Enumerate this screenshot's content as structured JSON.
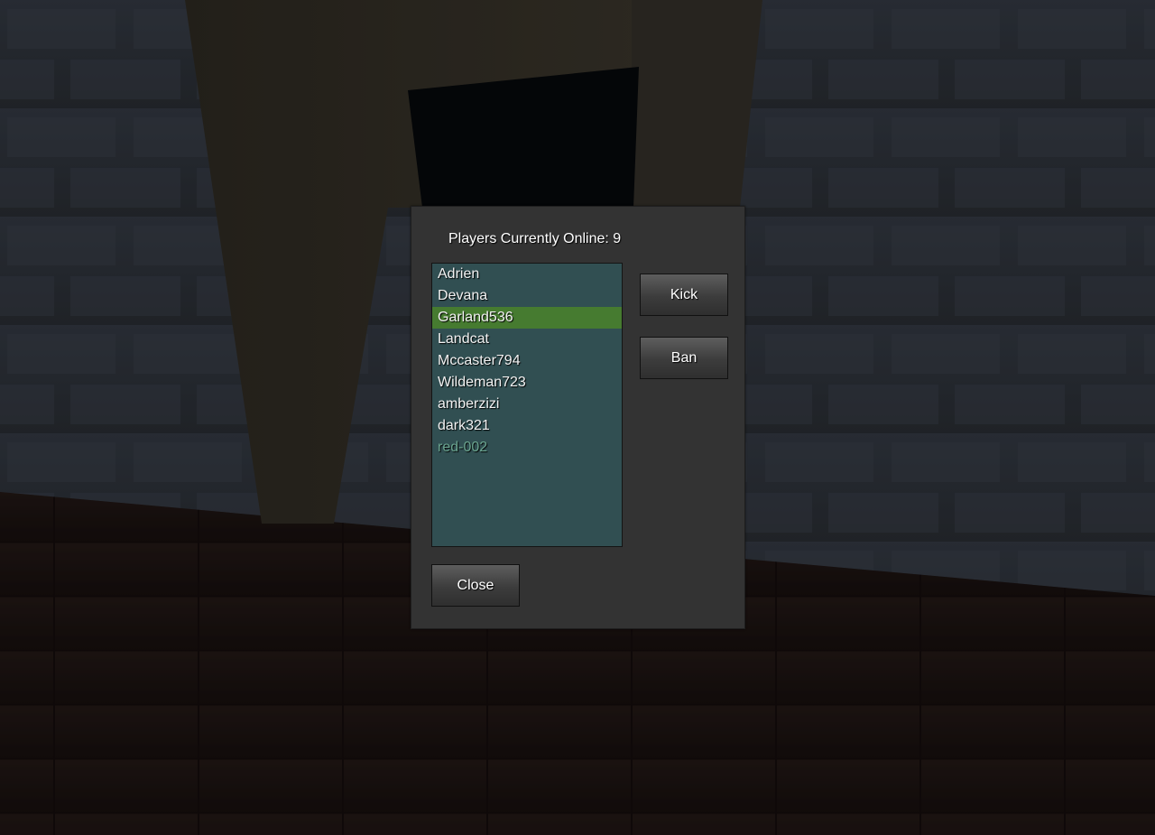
{
  "dialog": {
    "title": "Players Currently Online: 9",
    "players": [
      {
        "name": "Adrien",
        "state": "normal"
      },
      {
        "name": "Devana",
        "state": "normal"
      },
      {
        "name": "Garland536",
        "state": "selected"
      },
      {
        "name": "Landcat",
        "state": "normal"
      },
      {
        "name": "Mccaster794",
        "state": "normal"
      },
      {
        "name": "Wildeman723",
        "state": "normal"
      },
      {
        "name": "amberzizi",
        "state": "normal"
      },
      {
        "name": "dark321",
        "state": "normal"
      },
      {
        "name": "red-002",
        "state": "dim"
      }
    ],
    "kick_label": "Kick",
    "ban_label": "Ban",
    "close_label": "Close"
  },
  "colors": {
    "panel": "#333333",
    "list_background": "#314f52",
    "selected_row": "#467b30",
    "dim_text": "#6aa48f"
  }
}
